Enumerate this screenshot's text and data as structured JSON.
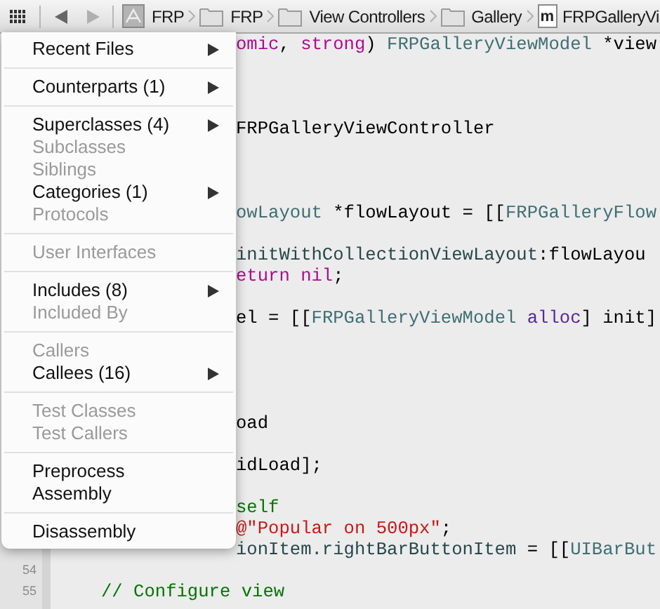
{
  "jump_bar": {
    "items": [
      {
        "kind": "project",
        "label": "FRP"
      },
      {
        "kind": "folder",
        "label": "FRP"
      },
      {
        "kind": "folder",
        "label": "View Controllers"
      },
      {
        "kind": "folder",
        "label": "Gallery"
      },
      {
        "kind": "file",
        "file_letter": "m",
        "label": "FRPGalleryVi"
      }
    ]
  },
  "editor": {
    "lines": [
      {
        "kind": "covered",
        "segments": [
          {
            "kind": "keyword",
            "text": "omic"
          },
          {
            "kind": "plain",
            "text": ", "
          },
          {
            "kind": "keyword",
            "text": "strong"
          },
          {
            "kind": "plain",
            "text": ") "
          },
          {
            "kind": "type",
            "text": "FRPGalleryViewModel"
          },
          {
            "kind": "plain",
            "text": " *view"
          }
        ]
      },
      {
        "kind": "blank"
      },
      {
        "kind": "blank"
      },
      {
        "kind": "blank"
      },
      {
        "kind": "covered",
        "segments": [
          {
            "kind": "plain",
            "text": "FRPGalleryViewController"
          }
        ]
      },
      {
        "kind": "blank"
      },
      {
        "kind": "blank"
      },
      {
        "kind": "blank"
      },
      {
        "kind": "covered",
        "segments": [
          {
            "kind": "type",
            "text": "owLayout"
          },
          {
            "kind": "plain",
            "text": " *flowLayout = [["
          },
          {
            "kind": "type",
            "text": "FRPGalleryFlow"
          }
        ]
      },
      {
        "kind": "blank"
      },
      {
        "kind": "covered",
        "segments": [
          {
            "kind": "method",
            "text": "initWithCollectionViewLayout"
          },
          {
            "kind": "plain",
            "text": ":flowLayou"
          }
        ]
      },
      {
        "kind": "covered",
        "segments": [
          {
            "kind": "keyword",
            "text": "eturn nil"
          },
          {
            "kind": "plain",
            "text": ";"
          }
        ]
      },
      {
        "kind": "blank"
      },
      {
        "kind": "covered",
        "segments": [
          {
            "kind": "plain",
            "text": "el = [["
          },
          {
            "kind": "type",
            "text": "FRPGalleryViewModel"
          },
          {
            "kind": "message",
            "text": " alloc"
          },
          {
            "kind": "plain",
            "text": "] init]"
          }
        ]
      },
      {
        "kind": "blank"
      },
      {
        "kind": "blank"
      },
      {
        "kind": "blank"
      },
      {
        "kind": "blank"
      },
      {
        "kind": "covered",
        "segments": [
          {
            "kind": "plain",
            "text": "oad"
          }
        ]
      },
      {
        "kind": "blank"
      },
      {
        "kind": "covered",
        "segments": [
          {
            "kind": "plain",
            "text": "idLoad];"
          }
        ]
      },
      {
        "kind": "blank"
      },
      {
        "kind": "covered",
        "segments": [
          {
            "kind": "comment",
            "text": "self"
          }
        ]
      },
      {
        "kind": "covered",
        "segments": [
          {
            "kind": "string",
            "text": "@\"Popular on 500px\""
          },
          {
            "kind": "plain",
            "text": ";"
          }
        ]
      },
      {
        "kind": "covered",
        "segments": [
          {
            "kind": "method",
            "text": "ionItem.rightBarButtonItem"
          },
          {
            "kind": "plain",
            "text": " = [["
          },
          {
            "kind": "type",
            "text": "UIBarBut"
          }
        ]
      },
      {
        "kind": "full",
        "number": "54"
      },
      {
        "kind": "full",
        "number": "55",
        "segments": [
          {
            "kind": "comment",
            "text": "// Configure view"
          }
        ]
      }
    ]
  },
  "menu": {
    "items": [
      {
        "kind": "item",
        "label": "Recent Files",
        "enabled": true,
        "submenu": true
      },
      {
        "kind": "separator"
      },
      {
        "kind": "item",
        "label": "Counterparts (1)",
        "enabled": true,
        "submenu": true
      },
      {
        "kind": "separator"
      },
      {
        "kind": "item",
        "label": "Superclasses (4)",
        "enabled": true,
        "submenu": true
      },
      {
        "kind": "item",
        "label": "Subclasses",
        "enabled": false,
        "submenu": false
      },
      {
        "kind": "item",
        "label": "Siblings",
        "enabled": false,
        "submenu": false
      },
      {
        "kind": "item",
        "label": "Categories (1)",
        "enabled": true,
        "submenu": true
      },
      {
        "kind": "item",
        "label": "Protocols",
        "enabled": false,
        "submenu": false
      },
      {
        "kind": "separator"
      },
      {
        "kind": "item",
        "label": "User Interfaces",
        "enabled": false,
        "submenu": false
      },
      {
        "kind": "separator"
      },
      {
        "kind": "item",
        "label": "Includes (8)",
        "enabled": true,
        "submenu": true
      },
      {
        "kind": "item",
        "label": "Included By",
        "enabled": false,
        "submenu": false
      },
      {
        "kind": "separator"
      },
      {
        "kind": "item",
        "label": "Callers",
        "enabled": false,
        "submenu": false
      },
      {
        "kind": "item",
        "label": "Callees (16)",
        "enabled": true,
        "submenu": true
      },
      {
        "kind": "separator"
      },
      {
        "kind": "item",
        "label": "Test Classes",
        "enabled": false,
        "submenu": false
      },
      {
        "kind": "item",
        "label": "Test Callers",
        "enabled": false,
        "submenu": false
      },
      {
        "kind": "separator"
      },
      {
        "kind": "item",
        "label": "Preprocess",
        "enabled": true,
        "submenu": false
      },
      {
        "kind": "item",
        "label": "Assembly",
        "enabled": true,
        "submenu": false
      },
      {
        "kind": "separator"
      },
      {
        "kind": "item",
        "label": "Disassembly",
        "enabled": true,
        "submenu": false
      }
    ]
  }
}
